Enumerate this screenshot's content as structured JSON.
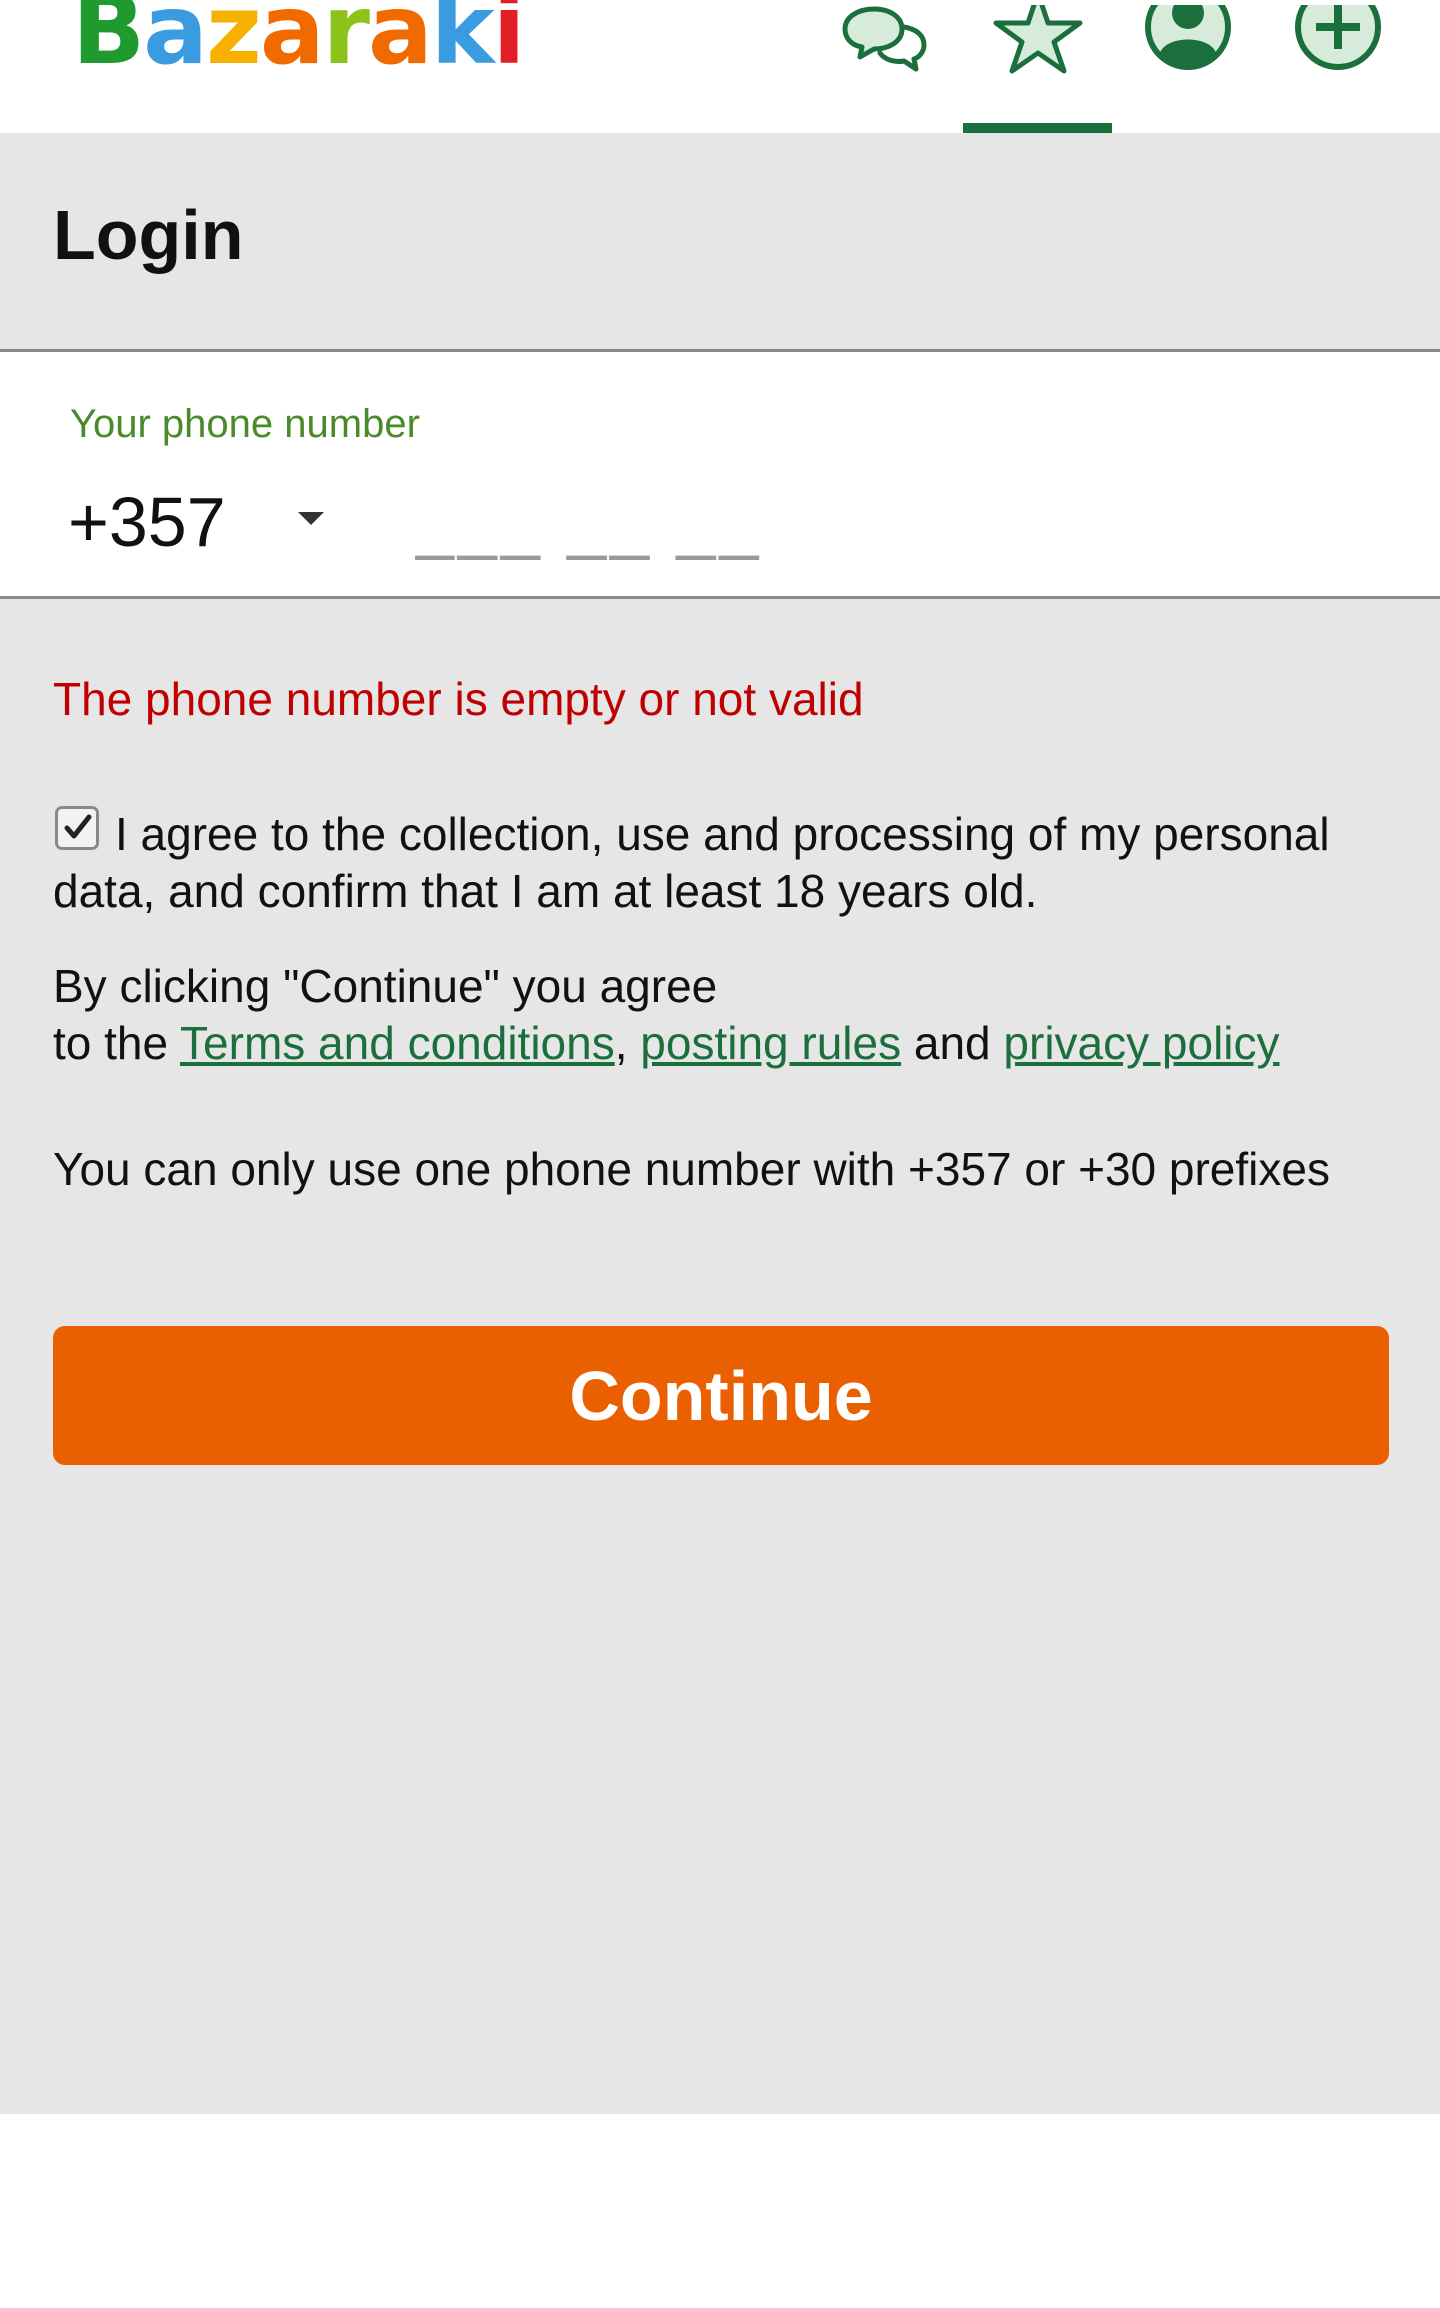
{
  "header": {
    "logo_text": "Bazaraki",
    "logo_colors": [
      "#1f9a2e",
      "#3b9be0",
      "#f5b000",
      "#f06a00",
      "#8cc21a",
      "#f06a00",
      "#3b9be0",
      "#e21f26"
    ],
    "icons": [
      "chat-icon",
      "favorites-icon",
      "profile-icon",
      "add-listing-icon"
    ],
    "active_tab": "favorites-icon",
    "accent_color": "#1b6f3c"
  },
  "login": {
    "title": "Login",
    "phone_label": "Your phone number",
    "country_code": "+357",
    "phone_placeholder": "___ __ __",
    "phone_value": "",
    "error": "The phone number is empty or not valid",
    "consent_checked": true,
    "consent_text": "I agree to the collection, use and processing of my personal data, and confirm that I am at least 18 years old.",
    "terms_line1": "By clicking \"Continue\" you agree",
    "terms_prefix": "to the ",
    "terms_link": "Terms and conditions",
    "comma": ",",
    "rules_link": "posting rules",
    "and_text": " and ",
    "privacy_link": "privacy policy",
    "note": "You can only use one phone number with +357 or +30 prefixes",
    "continue_label": "Continue",
    "continue_color": "#ea5f00",
    "error_color": "#c00000"
  }
}
